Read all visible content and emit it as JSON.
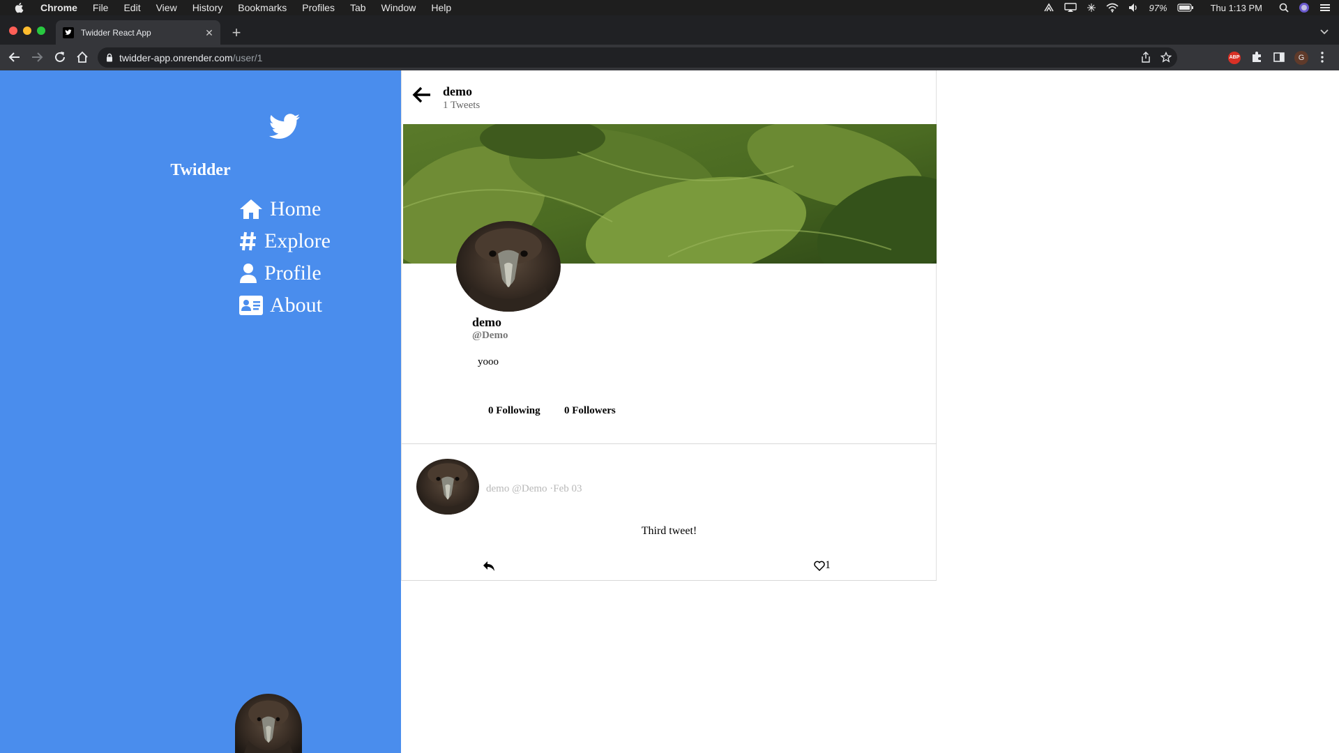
{
  "menubar": {
    "app": "Chrome",
    "items": [
      "File",
      "Edit",
      "View",
      "History",
      "Bookmarks",
      "Profiles",
      "Tab",
      "Window",
      "Help"
    ],
    "battery": "97%",
    "clock": "Thu 1:13 PM"
  },
  "browser": {
    "tab_title": "Twidder React App",
    "url_host": "twidder-app.onrender.com",
    "url_path": "/user/1",
    "profile_initial": "G",
    "adblock_label": "ABP"
  },
  "sidebar": {
    "brand": "Twidder",
    "nav": [
      {
        "label": "Home",
        "icon": "home-icon"
      },
      {
        "label": "Explore",
        "icon": "hashtag-icon"
      },
      {
        "label": "Profile",
        "icon": "user-icon"
      },
      {
        "label": "About",
        "icon": "id-card-icon"
      }
    ]
  },
  "profile": {
    "header_name": "demo",
    "tweet_count": "1 Tweets",
    "name": "demo",
    "handle": "@Demo",
    "bio": "yooo",
    "following": "0 Following",
    "followers": "0 Followers"
  },
  "tweets": [
    {
      "meta": "demo @Demo ·Feb 03",
      "text": "Third tweet!",
      "likes": "1"
    }
  ],
  "colors": {
    "sidebar": "#4a8ded",
    "menubar": "#1e1e1e",
    "tabstrip": "#202124",
    "toolbar": "#35363a"
  }
}
